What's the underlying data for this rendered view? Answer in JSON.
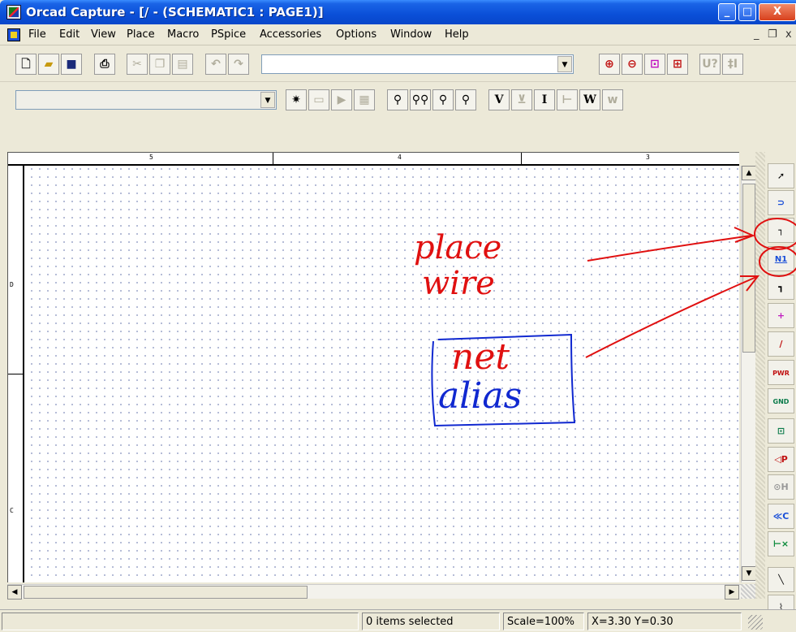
{
  "window": {
    "title": "Orcad Capture - [/ - (SCHEMATIC1 : PAGE1)]",
    "controls": [
      "_",
      "□",
      "X"
    ]
  },
  "menu": {
    "items": [
      "File",
      "Edit",
      "View",
      "Place",
      "Macro",
      "PSpice",
      "Accessories",
      "Options",
      "Window",
      "Help"
    ],
    "mdi_controls": [
      "_",
      "❐",
      "x"
    ]
  },
  "toolbar1": {
    "part_combo_value": "",
    "buttons": [
      "new-icon",
      "open-icon",
      "save-icon",
      "print-icon",
      "cut-icon",
      "copy-icon",
      "paste-icon",
      "undo-icon",
      "redo-icon",
      "zoom-in-icon",
      "zoom-out-icon",
      "zoom-area-icon",
      "zoom-all-icon",
      "annotate-icon",
      "back-annotate-icon"
    ],
    "extra_labels": [
      "U?",
      "‡I"
    ]
  },
  "toolbar2": {
    "sim_combo_value": "",
    "probe_labels": [
      "V",
      "I",
      "W"
    ]
  },
  "canvas": {
    "ruler_top": [
      "5",
      "4",
      "3"
    ],
    "ruler_left": [
      "D",
      "C"
    ]
  },
  "palette": {
    "tools": [
      {
        "name": "select-tool",
        "glyph": "➚",
        "color": "#000"
      },
      {
        "name": "place-part-tool",
        "glyph": "⊃",
        "color": "#1a4fd8"
      },
      {
        "name": "place-wire-tool",
        "glyph": "┐",
        "color": "#000"
      },
      {
        "name": "place-net-alias-tool",
        "glyph": "N1",
        "color": "#1a4fd8"
      },
      {
        "name": "place-bus-tool",
        "glyph": "┓",
        "color": "#000"
      },
      {
        "name": "place-junction-tool",
        "glyph": "+",
        "color": "#c020c0"
      },
      {
        "name": "place-bus-entry-tool",
        "glyph": "∕",
        "color": "#c01010"
      },
      {
        "name": "place-power-tool",
        "glyph": "PWR",
        "color": "#c01010"
      },
      {
        "name": "place-ground-tool",
        "glyph": "GND",
        "color": "#0a7a4a"
      },
      {
        "name": "place-hier-block-tool",
        "glyph": "⊡",
        "color": "#0a7a4a"
      },
      {
        "name": "place-port-tool",
        "glyph": "◁P",
        "color": "#c01010"
      },
      {
        "name": "place-hier-pin-tool",
        "glyph": "⊙H",
        "color": "#999"
      },
      {
        "name": "place-off-page-tool",
        "glyph": "≪C",
        "color": "#1a4fd8"
      },
      {
        "name": "place-no-connect-tool",
        "glyph": "⊢×",
        "color": "#0a8a3a"
      },
      {
        "name": "place-line-tool",
        "glyph": "╲",
        "color": "#000"
      },
      {
        "name": "place-polyline-tool",
        "glyph": "⌇",
        "color": "#555"
      }
    ]
  },
  "status": {
    "selection": "0 items selected",
    "scale": "Scale=100%",
    "coords": "X=3.30  Y=0.30"
  },
  "annotations": {
    "line1": "place",
    "line2": "wire",
    "box_line1": "net",
    "box_line2": "alias",
    "red": "#e01010",
    "blue": "#1028d0"
  },
  "colors": {
    "titlebar": "#0a4fd8",
    "chrome": "#ece9d8"
  }
}
